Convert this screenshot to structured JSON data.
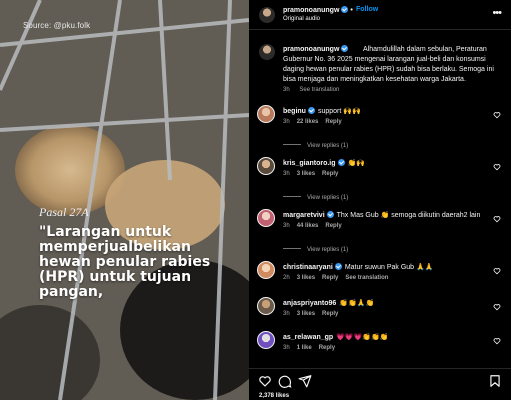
{
  "media": {
    "source": "Source: @pku.folk",
    "pasal": "Pasal 27A",
    "quote": "\"Larangan untuk memperjualbelikan hewan penular rabies (HPR) untuk tujuan pangan,"
  },
  "header": {
    "username": "pramonoanungw",
    "follow_label": "Follow",
    "audio": "Original audio",
    "more": "•••"
  },
  "caption": {
    "username": "pramonoanungw",
    "text": "Alhamdulillah dalam sebulan, Peraturan Gubernur No. 36 2025 mengenai larangan jual-beli dan konsumsi daging hewan penular rabies (HPR) sudah bisa berlaku. Semoga ini bisa menjaga dan meningkatkan kesehatan warga Jakarta.",
    "time": "3h",
    "see_translation": "See translation"
  },
  "comments": [
    {
      "username": "beginu",
      "verified": true,
      "text": "support 🙌🙌",
      "time": "3h",
      "likes": "22 likes",
      "reply": "Reply",
      "see_translation": "",
      "replies": "View replies (1)"
    },
    {
      "username": "kris_giantoro.ig",
      "verified": true,
      "text": "👏🙌",
      "time": "3h",
      "likes": "3 likes",
      "reply": "Reply",
      "see_translation": "",
      "replies": "View replies (1)"
    },
    {
      "username": "margaretvivi",
      "verified": true,
      "text": "Thx Mas Gub 👏 semoga diikutin daerah2 lain",
      "time": "3h",
      "likes": "44 likes",
      "reply": "Reply",
      "see_translation": "",
      "replies": "View replies (1)"
    },
    {
      "username": "christinaaryani",
      "verified": true,
      "text": "Matur suwun Pak Gub 🙏🙏",
      "time": "2h",
      "likes": "3 likes",
      "reply": "Reply",
      "see_translation": "See translation",
      "replies": ""
    },
    {
      "username": "anjaspriyanto96",
      "verified": false,
      "text": "👏👏🙏👏",
      "time": "3h",
      "likes": "3 likes",
      "reply": "Reply",
      "see_translation": "",
      "replies": ""
    },
    {
      "username": "as_relawan_gp",
      "verified": false,
      "text": "💗💗💗👏👏👏",
      "time": "3h",
      "likes": "1 like",
      "reply": "Reply",
      "see_translation": "",
      "replies": ""
    }
  ],
  "footer": {
    "likes": "2,378 likes"
  },
  "colors": {
    "accent": "#0095f6",
    "verified": "#3797f0",
    "muted": "#a8a8a8"
  }
}
